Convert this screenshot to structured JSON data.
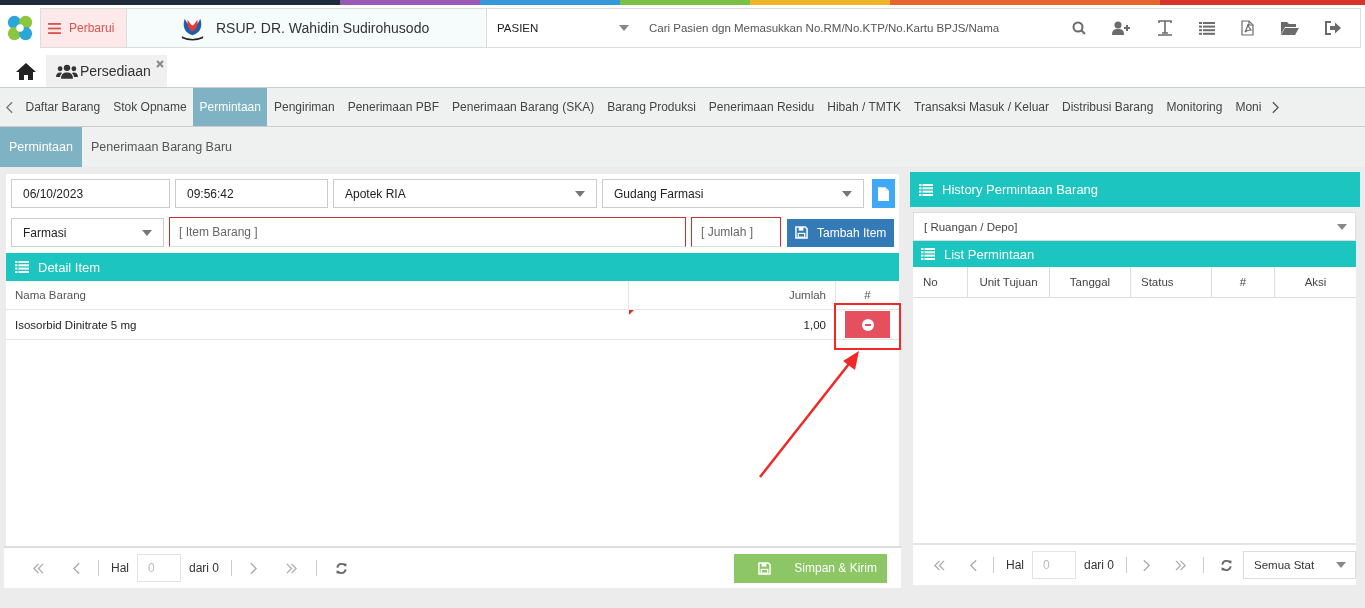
{
  "header": {
    "menu_button": "Perbarui",
    "hospital": "RSUP. DR. Wahidin Sudirohusodo",
    "search_type": "PASIEN",
    "search_placeholder": "Cari Pasien dgn Memasukkan No.RM/No.KTP/No.Kartu BPJS/Nama"
  },
  "open_tabs": [
    {
      "label": "Persediaan",
      "selected": true
    }
  ],
  "nav": {
    "items": [
      {
        "label": "Daftar Barang",
        "selected": false
      },
      {
        "label": "Stok Opname",
        "selected": false
      },
      {
        "label": "Permintaan",
        "selected": true
      },
      {
        "label": "Pengiriman",
        "selected": false
      },
      {
        "label": "Penerimaan PBF",
        "selected": false
      },
      {
        "label": "Penerimaan Barang (SKA)",
        "selected": false
      },
      {
        "label": "Barang Produksi",
        "selected": false
      },
      {
        "label": "Penerimaan Residu",
        "selected": false
      },
      {
        "label": "Hibah / TMTK",
        "selected": false
      },
      {
        "label": "Transaksi Masuk / Keluar",
        "selected": false
      },
      {
        "label": "Distribusi Barang",
        "selected": false
      },
      {
        "label": "Monitoring",
        "selected": false
      },
      {
        "label": "Moni",
        "selected": false
      }
    ]
  },
  "subnav": [
    {
      "label": "Permintaan",
      "selected": true
    },
    {
      "label": "Penerimaan Barang Baru",
      "selected": false
    }
  ],
  "form": {
    "date": "06/10/2023",
    "time": "09:56:42",
    "unit": "Apotek RIA",
    "warehouse": "Gudang Farmasi",
    "category": "Farmasi",
    "item_placeholder": "[ Item Barang ]",
    "qty_placeholder": "[ Jumlah ]",
    "add_button": "Tambah Item"
  },
  "detail": {
    "title": "Detail Item",
    "columns": [
      "Nama Barang",
      "Jumlah",
      "#"
    ],
    "rows": [
      {
        "name": "Isosorbid Dinitrate 5 mg",
        "qty": "1,00"
      }
    ],
    "pager": {
      "page_label": "Hal",
      "page_placeholder": "0",
      "of": "dari 0"
    },
    "save_button": "Simpan & Kirim"
  },
  "history": {
    "title": "History Permintaan Barang",
    "filter_placeholder": "[ Ruangan / Depo]",
    "list_title": "List Permintaan",
    "columns": [
      "No",
      "Unit Tujuan",
      "Tanggal",
      "Status",
      "#",
      "Aksi"
    ],
    "pager": {
      "page_label": "Hal",
      "page_placeholder": "0",
      "of": "dari 0"
    },
    "status_filter": "Semua Stat"
  }
}
